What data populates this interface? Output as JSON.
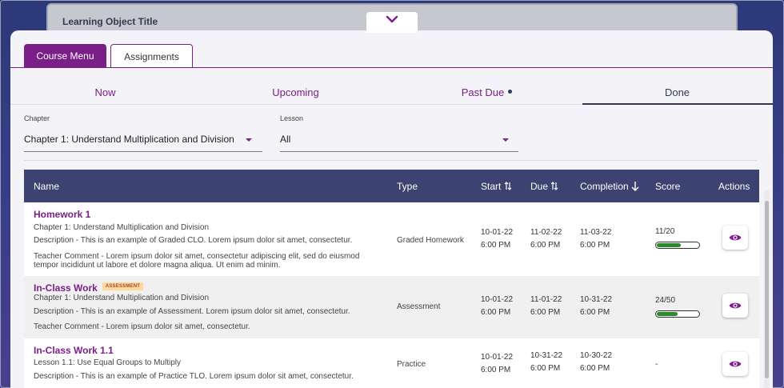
{
  "learning_object": {
    "title": "Learning Object Title",
    "toggle_icon": "chevron-down-icon"
  },
  "menu_tabs": {
    "course_menu": "Course Menu",
    "assignments": "Assignments"
  },
  "status_tabs": {
    "now": "Now",
    "upcoming": "Upcoming",
    "past_due": "Past Due",
    "done": "Done",
    "selected": "Done"
  },
  "filters": {
    "chapter": {
      "label": "Chapter",
      "value": "Chapter 1: Understand Multiplication and Division"
    },
    "lesson": {
      "label": "Lesson",
      "value": "All"
    }
  },
  "table": {
    "headers": {
      "name": "Name",
      "type": "Type",
      "start": "Start",
      "due": "Due",
      "completion": "Completion",
      "score": "Score",
      "actions": "Actions"
    },
    "sort_icons": {
      "start": "sort-both-icon",
      "due": "sort-both-icon",
      "completion": "arrow-down-icon"
    },
    "rows": [
      {
        "name": "Homework 1",
        "badge": "",
        "line1": "Chapter 1: Understand Multiplication and Division",
        "line2": "Description - This is an example of Graded CLO. Lorem ipsum dolor sit amet, consectetur.",
        "line3": "Teacher Comment - Lorem ipsum dolor sit amet, consectetur adipiscing elit, sed do eiusmod",
        "line4": "tempor incididunt ut labore et dolore magna aliqua. Ut enim ad minim.",
        "type": "Graded Homework",
        "start_date": "10-01-22",
        "start_time": "6:00 PM",
        "due_date": "11-02-22",
        "due_time": "6:00 PM",
        "completion_date": "11-03-22",
        "completion_time": "6:00 PM",
        "score": "11/20",
        "score_fraction": 0.55
      },
      {
        "name": "In-Class Work",
        "badge": "ASSESSMENT",
        "line1": "Chapter 1: Understand Multiplication and Division",
        "line2": "Description - This is an example of Assessment. Lorem ipsum dolor sit amet, consectetur.",
        "line3": "Teacher Comment - Lorem ipsum dolor sit amet, consectetur.",
        "line4": "",
        "type": "Assessment",
        "start_date": "10-01-22",
        "start_time": "6:00 PM",
        "due_date": "11-01-22",
        "due_time": "6:00 PM",
        "completion_date": "10-31-22",
        "completion_time": "6:00 PM",
        "score": "24/50",
        "score_fraction": 0.48
      },
      {
        "name": "In-Class Work 1.1",
        "badge": "",
        "line1": "Lesson 1.1: Use Equal Groups to Multiply",
        "line2": "Description - This is an example of Practice TLO. Lorem ipsum dolor sit amet, consectetur.",
        "line3": "",
        "line4": "",
        "type": "Practice",
        "start_date": "10-01-22",
        "start_time": "6:00 PM",
        "due_date": "10-31-22",
        "due_time": "6:00 PM",
        "completion_date": "10-30-22",
        "completion_time": "6:00 PM",
        "score": "-",
        "score_fraction": null
      }
    ]
  },
  "action_icon": "eye-icon",
  "colors": {
    "brand_purple": "#7b1f88",
    "header_navy": "#3c4370",
    "progress_green": "#2c8a2c",
    "badge_bg": "#ffd7a0"
  }
}
